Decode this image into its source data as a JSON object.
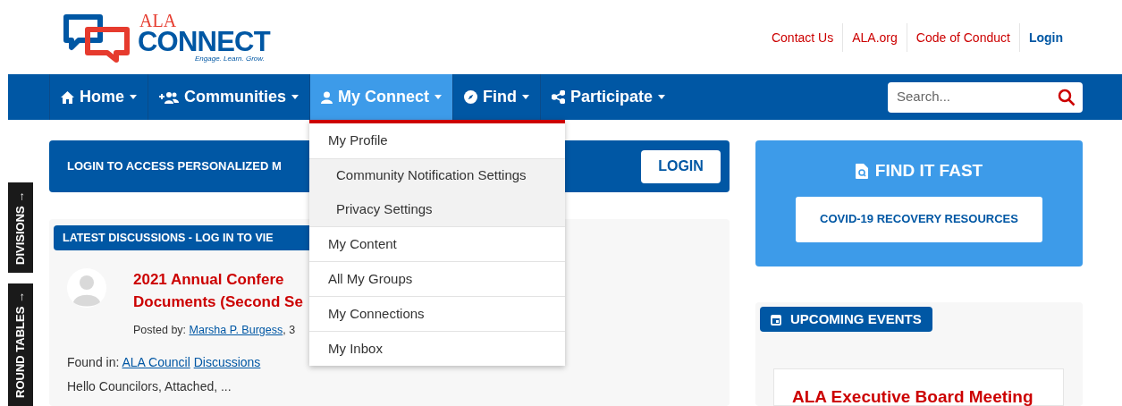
{
  "header": {
    "logo": {
      "top": "ALA",
      "name": "CONNECT",
      "tagline": "Engage. Learn. Grow."
    },
    "links": [
      {
        "label": "Contact Us",
        "kind": "link"
      },
      {
        "label": "ALA.org",
        "kind": "link"
      },
      {
        "label": "Code of Conduct",
        "kind": "link"
      },
      {
        "label": "Login",
        "kind": "login"
      }
    ]
  },
  "nav": {
    "items": [
      {
        "label": "Home",
        "selected": false
      },
      {
        "label": "Communities",
        "selected": false
      },
      {
        "label": "My Connect",
        "selected": true
      },
      {
        "label": "Find",
        "selected": false
      },
      {
        "label": "Participate",
        "selected": false
      }
    ],
    "search": {
      "placeholder": "Search..."
    }
  },
  "dropdown": {
    "items": [
      {
        "label": "My Profile",
        "kind": "item"
      },
      {
        "label": "Community Notification Settings",
        "kind": "subitem"
      },
      {
        "label": "Privacy Settings",
        "kind": "subitem"
      },
      {
        "label": "My Content",
        "kind": "item"
      },
      {
        "label": "All My Groups",
        "kind": "item"
      },
      {
        "label": "My Connections",
        "kind": "item"
      },
      {
        "label": "My Inbox",
        "kind": "item"
      }
    ]
  },
  "side_tabs": [
    "DIVISIONS →",
    "ROUND TABLES →"
  ],
  "login_banner": {
    "text": "LOGIN TO ACCESS PERSONALIZED M",
    "button": "LOGIN"
  },
  "discussions": {
    "heading": "LATEST DISCUSSIONS - LOG IN TO VIE",
    "post": {
      "title_lines": [
        "2021 Annual Confere",
        "Documents (Second Se"
      ],
      "posted_label": "Posted by:",
      "author": "Marsha P. Burgess",
      "posted_rest": ", 3",
      "found_label": "Found in:",
      "found_links": [
        "ALA Council",
        "Discussions"
      ],
      "excerpt": "Hello Councilors, Attached, ..."
    }
  },
  "find_it_fast": {
    "title": "FIND IT FAST",
    "button": "COVID-19 RECOVERY RESOURCES"
  },
  "events": {
    "heading": "UPCOMING EVENTS",
    "items": [
      {
        "title": "ALA Executive Board Meeting"
      }
    ]
  }
}
